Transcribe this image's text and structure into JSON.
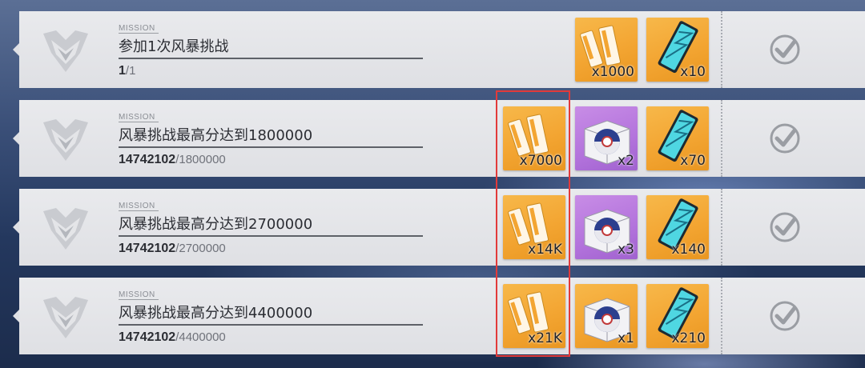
{
  "missions": [
    {
      "label": "MISSION",
      "title": "参加1次风暴挑战",
      "progress_current": "1",
      "progress_target": "/1",
      "rewards": [
        {
          "type": "ticket-gold",
          "count": "x1000"
        },
        {
          "type": "crystal-card",
          "count": "x10"
        }
      ]
    },
    {
      "label": "MISSION",
      "title": "风暴挑战最高分达到1800000",
      "progress_current": "14742102",
      "progress_target": "/1800000",
      "rewards": [
        {
          "type": "ticket-gold",
          "count": "x7000"
        },
        {
          "type": "supply-box-purple",
          "count": "x2"
        },
        {
          "type": "crystal-card",
          "count": "x70"
        }
      ]
    },
    {
      "label": "MISSION",
      "title": "风暴挑战最高分达到2700000",
      "progress_current": "14742102",
      "progress_target": "/2700000",
      "rewards": [
        {
          "type": "ticket-gold",
          "count": "x14K"
        },
        {
          "type": "supply-box-purple",
          "count": "x3"
        },
        {
          "type": "crystal-card",
          "count": "x140"
        }
      ]
    },
    {
      "label": "MISSION",
      "title": "风暴挑战最高分达到4400000",
      "progress_current": "14742102",
      "progress_target": "/4400000",
      "rewards": [
        {
          "type": "ticket-gold",
          "count": "x21K"
        },
        {
          "type": "supply-box-gold",
          "count": "x1"
        },
        {
          "type": "crystal-card",
          "count": "x210"
        }
      ]
    }
  ],
  "colors": {
    "row_bg": "#e4e5e8",
    "gold_reward": "#f3a532",
    "purple_reward": "#b373dc",
    "highlight": "#e23a3a",
    "check": "#9a9da3"
  },
  "icons": {
    "emblem": "mission-emblem-icon",
    "complete": "checkmark-icon"
  }
}
